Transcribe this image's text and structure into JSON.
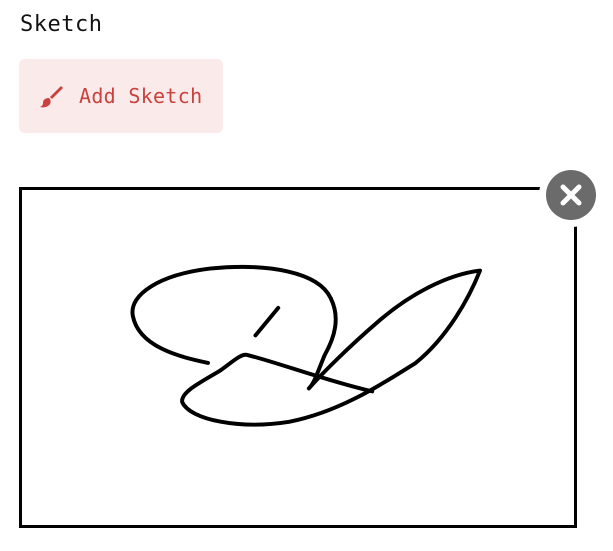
{
  "section": {
    "title": "Sketch"
  },
  "add_sketch": {
    "label": "Add Sketch",
    "icon": "paintbrush-icon",
    "accent_color": "#c9423d",
    "background_color": "#fbeaea"
  },
  "sketch_panel": {
    "border_color": "#000000",
    "stroke_color": "#000000",
    "remove_icon": "close-circle-icon",
    "remove_icon_color": "#6b6b6b"
  }
}
